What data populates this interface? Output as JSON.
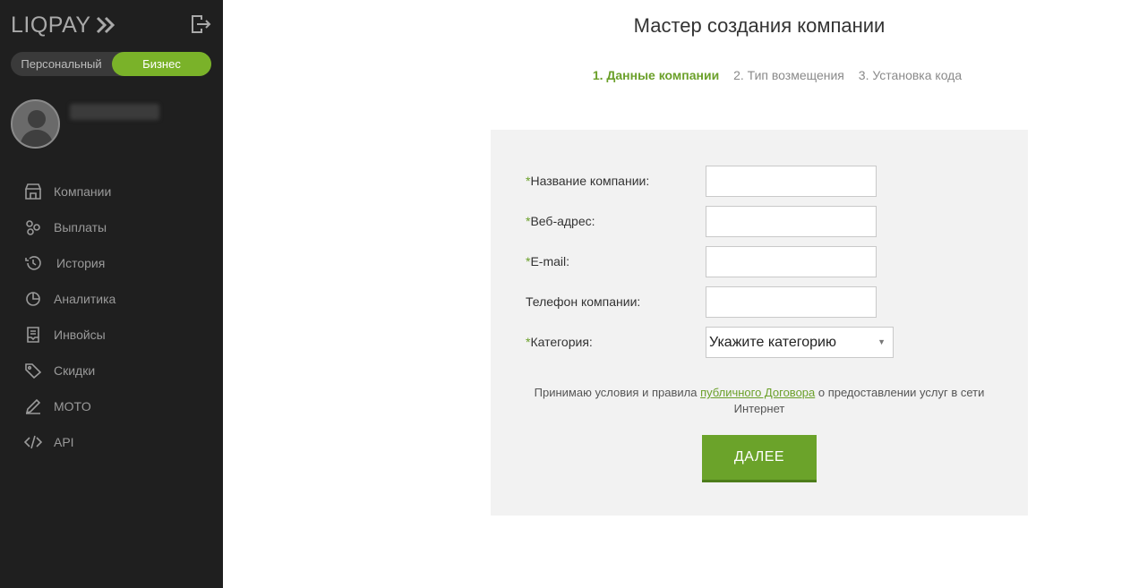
{
  "sidebar": {
    "logo_text": "LIQPAY",
    "toggle": {
      "personal": "Персональный",
      "business": "Бизнес",
      "active": "business"
    },
    "nav": [
      {
        "label": "Компании",
        "icon": "store-icon"
      },
      {
        "label": "Выплаты",
        "icon": "coins-icon"
      },
      {
        "label": "История",
        "icon": "history-icon"
      },
      {
        "label": "Аналитика",
        "icon": "pie-chart-icon"
      },
      {
        "label": "Инвойсы",
        "icon": "invoice-icon"
      },
      {
        "label": "Скидки",
        "icon": "tag-icon"
      },
      {
        "label": "MOTO",
        "icon": "pen-icon"
      },
      {
        "label": "API",
        "icon": "code-icon"
      }
    ]
  },
  "main": {
    "title": "Мастер создания компании",
    "steps": [
      "1. Данные компании",
      "2. Тип возмещения",
      "3. Установка кода"
    ],
    "form": {
      "company_name_label": "Название компании:",
      "web_label": "Веб-адрес:",
      "email_label": "E-mail:",
      "phone_label": "Телефон компании:",
      "category_label": "Категория:",
      "category_value": "Укажите категорию",
      "required_mark": "*"
    },
    "terms": {
      "before": "Принимаю условия и правила ",
      "link": "публичного Договора",
      "after": " о предоставлении услуг в сети Интернет"
    },
    "next_button": "ДАЛЕЕ"
  },
  "colors": {
    "accent": "#6ba02a",
    "sidebar_bg": "#1f1f1f",
    "panel_bg": "#f2f2f2"
  }
}
